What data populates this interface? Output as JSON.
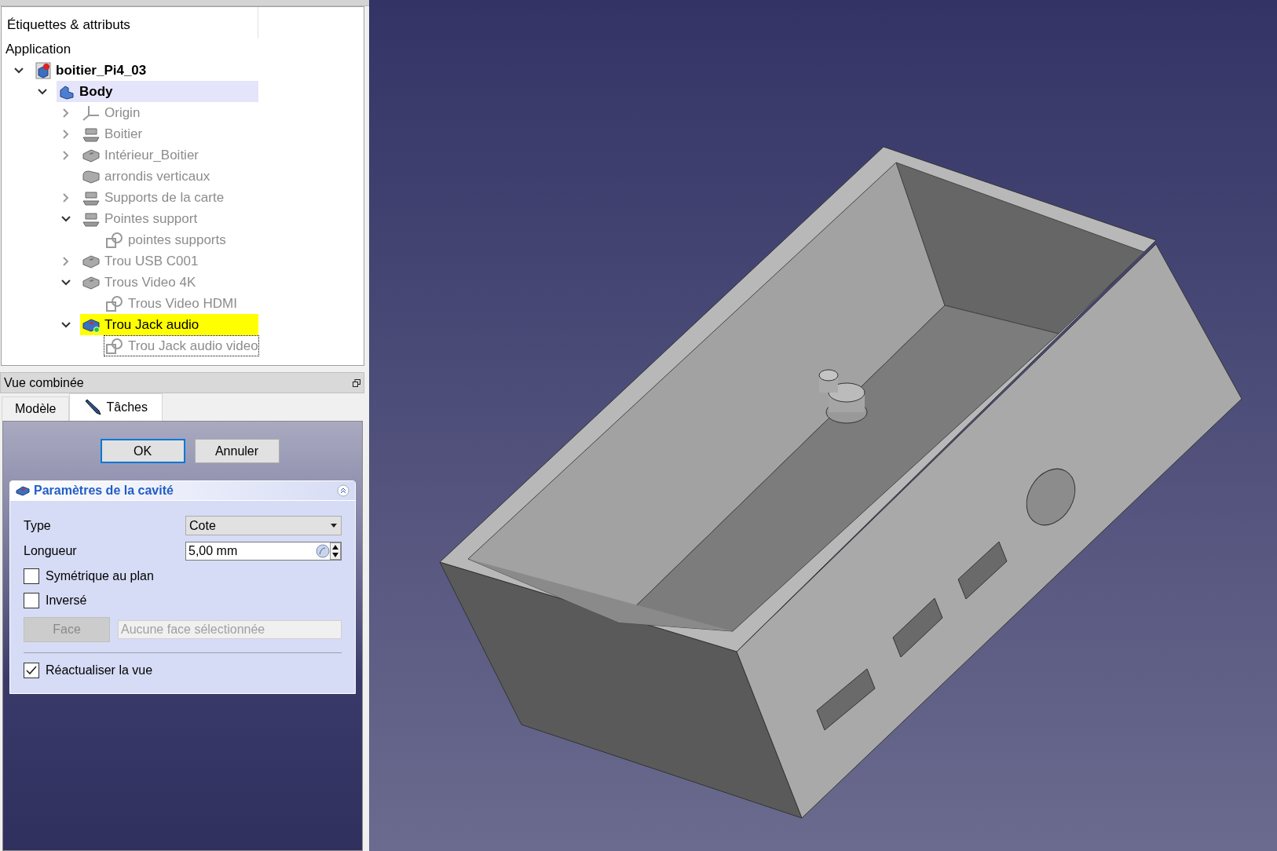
{
  "tree": {
    "column_header": "Étiquettes & attributs",
    "root_label": "Application",
    "items": [
      {
        "label": "boitier_Pi4_03",
        "kind": "document",
        "expandable": true,
        "expanded": true,
        "visible": true,
        "selected": false,
        "editing": false,
        "focused": false,
        "children": [
          {
            "label": "Body",
            "kind": "body",
            "expandable": true,
            "expanded": true,
            "visible": true,
            "selected": true,
            "editing": false,
            "focused": false,
            "children": [
              {
                "label": "Origin",
                "kind": "origin",
                "expandable": true,
                "expanded": false,
                "visible": false,
                "selected": false,
                "editing": false,
                "focused": false
              },
              {
                "label": "Boitier",
                "kind": "pad",
                "expandable": true,
                "expanded": false,
                "visible": false,
                "selected": false,
                "editing": false,
                "focused": false
              },
              {
                "label": "Intérieur_Boitier",
                "kind": "pocket",
                "expandable": true,
                "expanded": false,
                "visible": false,
                "selected": false,
                "editing": false,
                "focused": false
              },
              {
                "label": "arrondis verticaux",
                "kind": "fillet",
                "expandable": false,
                "visible": false,
                "selected": false,
                "editing": false,
                "focused": false
              },
              {
                "label": "Supports de la carte",
                "kind": "pad",
                "expandable": true,
                "expanded": false,
                "visible": false,
                "selected": false,
                "editing": false,
                "focused": false
              },
              {
                "label": "Pointes support",
                "kind": "pad",
                "expandable": true,
                "expanded": true,
                "visible": false,
                "selected": false,
                "editing": false,
                "focused": false,
                "children": [
                  {
                    "label": "pointes supports",
                    "kind": "sketch",
                    "expandable": false,
                    "visible": false,
                    "selected": false,
                    "editing": false,
                    "focused": false
                  }
                ]
              },
              {
                "label": "Trou USB C001",
                "kind": "pocket",
                "expandable": true,
                "expanded": false,
                "visible": false,
                "selected": false,
                "editing": false,
                "focused": false
              },
              {
                "label": "Trous Video 4K",
                "kind": "pocket",
                "expandable": true,
                "expanded": true,
                "visible": false,
                "selected": false,
                "editing": false,
                "focused": false,
                "children": [
                  {
                    "label": "Trous Video HDMI",
                    "kind": "sketch",
                    "expandable": false,
                    "visible": false,
                    "selected": false,
                    "editing": false,
                    "focused": false
                  }
                ]
              },
              {
                "label": "Trou Jack audio",
                "kind": "pocket-edit",
                "expandable": true,
                "expanded": true,
                "visible": true,
                "selected": false,
                "editing": true,
                "focused": false,
                "children": [
                  {
                    "label": "Trou Jack audio video",
                    "kind": "sketch",
                    "expandable": false,
                    "visible": false,
                    "selected": false,
                    "editing": false,
                    "focused": true
                  }
                ]
              }
            ]
          }
        ]
      }
    ]
  },
  "combo_view": {
    "title": "Vue combinée",
    "tabs": [
      {
        "label": "Modèle",
        "kind": "model",
        "selected": false
      },
      {
        "label": "Tâches",
        "kind": "tasks",
        "selected": true
      }
    ]
  },
  "task_panel": {
    "buttons": [
      {
        "label": "OK",
        "default": true
      },
      {
        "label": "Annuler",
        "default": false
      }
    ],
    "group": {
      "title": "Paramètres de la cavité",
      "expanded": true,
      "fields": [
        {
          "kind": "select",
          "label": "Type",
          "value": "Cote"
        },
        {
          "kind": "quantity",
          "label": "Longueur",
          "value": "5,00 mm"
        },
        {
          "kind": "checkbox",
          "label": "Symétrique au plan",
          "checked": false
        },
        {
          "kind": "checkbox",
          "label": "Inversé",
          "checked": false
        },
        {
          "kind": "face-picker",
          "button": "Face",
          "placeholder": "Aucune face sélectionnée",
          "disabled": true
        }
      ],
      "update_view": {
        "label": "Réactualiser la vue",
        "checked": true
      }
    }
  }
}
